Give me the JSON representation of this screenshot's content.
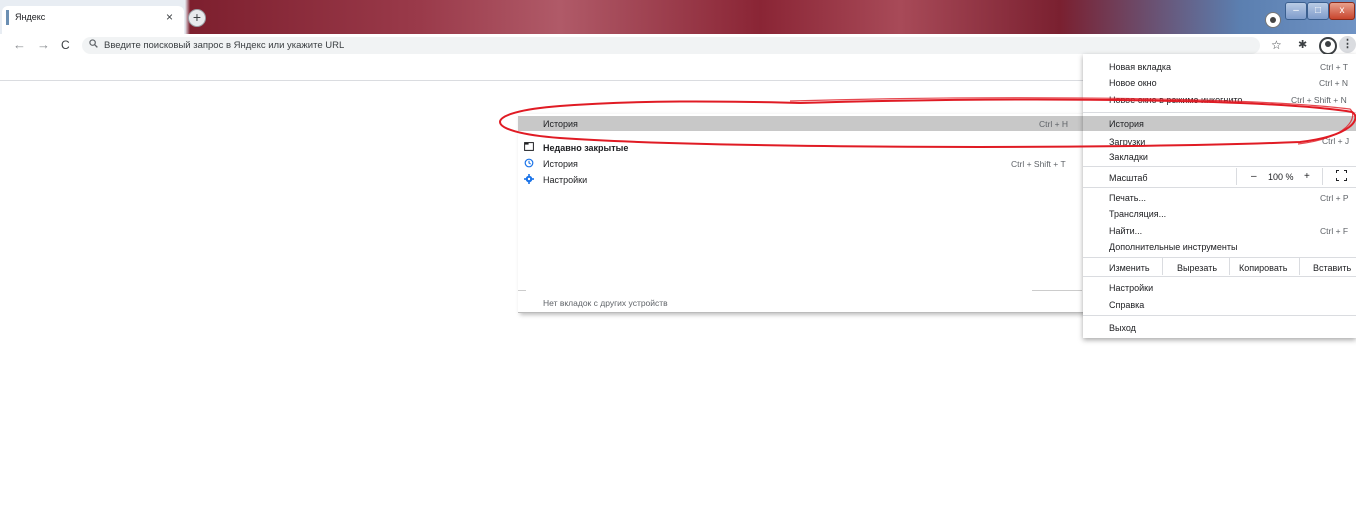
{
  "tab": {
    "title": "Яндекс",
    "close": "×",
    "new_tab": "+"
  },
  "window": {
    "minimize": "–",
    "maximize": "□",
    "close": "x"
  },
  "toolbar": {
    "back": "←",
    "forward": "→",
    "reload": "C",
    "search_icon": "🔍",
    "omnibox_placeholder": "Введите поисковый запрос в Яндекс или укажите URL",
    "star": "☆",
    "extensions": "✱",
    "menu": "⋮"
  },
  "history_submenu": {
    "header": {
      "label": "История",
      "shortcut": "Ctrl + H"
    },
    "recently_closed": "Недавно закрытые",
    "items": [
      {
        "icon": "history-icon",
        "label": "История",
        "shortcut": "Ctrl + Shift + T"
      },
      {
        "icon": "settings-gear-icon",
        "label": "Настройки",
        "shortcut": ""
      }
    ],
    "no_tabs": "Нет вкладок с других устройств"
  },
  "main_menu": {
    "new_tab": {
      "label": "Новая вкладка",
      "shortcut": "Ctrl + T"
    },
    "new_window": {
      "label": "Новое окно",
      "shortcut": "Ctrl + N"
    },
    "incognito": {
      "label": "Новое окно в режиме инкогнито",
      "shortcut": "Ctrl + Shift + N"
    },
    "history": {
      "label": "История"
    },
    "downloads": {
      "label": "Загрузки",
      "shortcut": "Ctrl + J"
    },
    "bookmarks": {
      "label": "Закладки"
    },
    "zoom": {
      "label": "Масштаб",
      "minus": "–",
      "value": "100 %",
      "plus": "+"
    },
    "print": {
      "label": "Печать...",
      "shortcut": "Ctrl + P"
    },
    "cast": {
      "label": "Трансляция..."
    },
    "find": {
      "label": "Найти...",
      "shortcut": "Ctrl + F"
    },
    "more_tools": {
      "label": "Дополнительные инструменты"
    },
    "edit": {
      "label": "Изменить",
      "cut": "Вырезать",
      "copy": "Копировать",
      "paste": "Вставить"
    },
    "settings": {
      "label": "Настройки"
    },
    "help": {
      "label": "Справка"
    },
    "exit": {
      "label": "Выход"
    }
  },
  "colors": {
    "annotation": "#e01b24",
    "highlight": "#c8c8c8",
    "accent_tab": "#6b8fb3"
  }
}
